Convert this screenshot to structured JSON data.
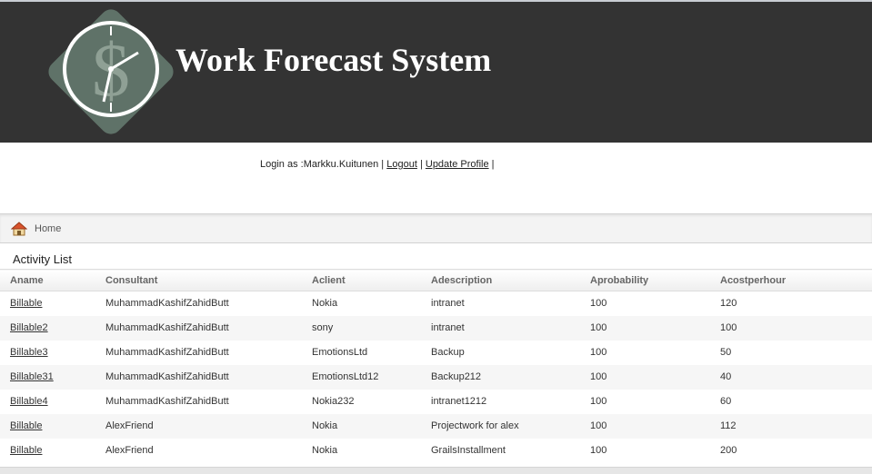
{
  "header": {
    "title": "Work Forecast System",
    "logo_icon": "clock-dollar-logo"
  },
  "login": {
    "prefix": "Login as :Markku.Kuitunen |",
    "logout": "Logout",
    "separator1": "|",
    "update_profile": "Update Profile",
    "separator2": "|"
  },
  "nav": {
    "home_label": "Home",
    "home_icon": "house-icon"
  },
  "activity_list": {
    "title": "Activity List",
    "columns": [
      "Aname",
      "Consultant",
      "Aclient",
      "Adescription",
      "Aprobability",
      "Acostperhour"
    ],
    "rows": [
      [
        "Billable",
        "MuhammadKashifZahidButt",
        "Nokia",
        "intranet",
        "100",
        "120"
      ],
      [
        "Billable2",
        "MuhammadKashifZahidButt",
        "sony",
        "intranet",
        "100",
        "100"
      ],
      [
        "Billable3",
        "MuhammadKashifZahidButt",
        "EmotionsLtd",
        "Backup",
        "100",
        "50"
      ],
      [
        "Billable31",
        "MuhammadKashifZahidButt",
        "EmotionsLtd12",
        "Backup212",
        "100",
        "40"
      ],
      [
        "Billable4",
        "MuhammadKashifZahidButt",
        "Nokia232",
        "intranet1212",
        "100",
        "60"
      ],
      [
        "Billable",
        "AlexFriend",
        "Nokia",
        "Projectwork for alex",
        "100",
        "112"
      ],
      [
        "Billable",
        "AlexFriend",
        "Nokia",
        "GrailsInstallment",
        "100",
        "200"
      ]
    ]
  },
  "colors": {
    "header_bg": "#333333",
    "logo_bg": "#5f7268",
    "title_text": "#ffffff"
  }
}
